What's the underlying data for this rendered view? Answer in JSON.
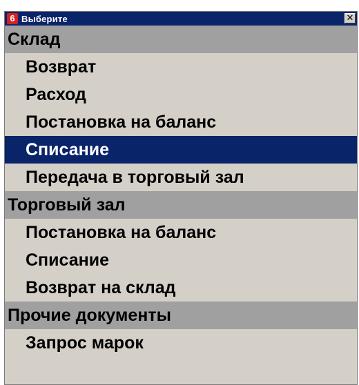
{
  "window": {
    "title": "Выберите",
    "app_icon_label": "6",
    "close_glyph": "✕"
  },
  "menu": [
    {
      "kind": "group",
      "label": "Склад"
    },
    {
      "kind": "item",
      "label": "Возврат"
    },
    {
      "kind": "item",
      "label": "Расход"
    },
    {
      "kind": "item",
      "label": "Постановка на баланс"
    },
    {
      "kind": "item",
      "label": "Списание",
      "selected": true
    },
    {
      "kind": "item",
      "label": "Передача в торговый зал"
    },
    {
      "kind": "group",
      "label": "Торговый зал"
    },
    {
      "kind": "item",
      "label": "Постановка на баланс"
    },
    {
      "kind": "item",
      "label": "Списание"
    },
    {
      "kind": "item",
      "label": "Возврат на склад"
    },
    {
      "kind": "group",
      "label": "Прочие документы"
    },
    {
      "kind": "item",
      "label": "Запрос марок"
    }
  ],
  "colors": {
    "titlebar": "#0a246a",
    "selection": "#0a246a",
    "group_header": "#a0a0a0",
    "window_bg": "#d4d0c8",
    "app_icon": "#d42020"
  }
}
